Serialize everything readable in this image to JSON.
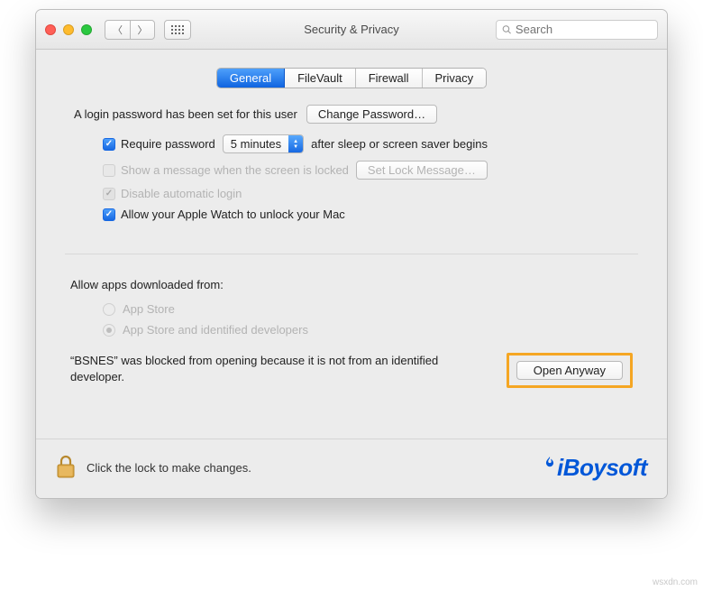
{
  "window": {
    "title": "Security & Privacy"
  },
  "search": {
    "placeholder": "Search"
  },
  "tabs": [
    "General",
    "FileVault",
    "Firewall",
    "Privacy"
  ],
  "section1": {
    "login_set_msg": "A login password has been set for this user",
    "change_password_btn": "Change Password…",
    "require_pw_label": "Require password",
    "require_pw_select": "5 minutes",
    "require_pw_suffix": "after sleep or screen saver begins",
    "show_message_label": "Show a message when the screen is locked",
    "set_lock_msg_btn": "Set Lock Message…",
    "disable_auto_login": "Disable automatic login",
    "apple_watch": "Allow your Apple Watch to unlock your Mac"
  },
  "section2": {
    "heading": "Allow apps downloaded from:",
    "opt_appstore": "App Store",
    "opt_identified": "App Store and identified developers",
    "blocked_msg": "“BSNES” was blocked from opening because it is not from an identified developer.",
    "open_anyway_btn": "Open Anyway"
  },
  "footer": {
    "lock_msg": "Click the lock to make changes.",
    "brand": "iBoysoft"
  },
  "watermark": "wsxdn.com"
}
